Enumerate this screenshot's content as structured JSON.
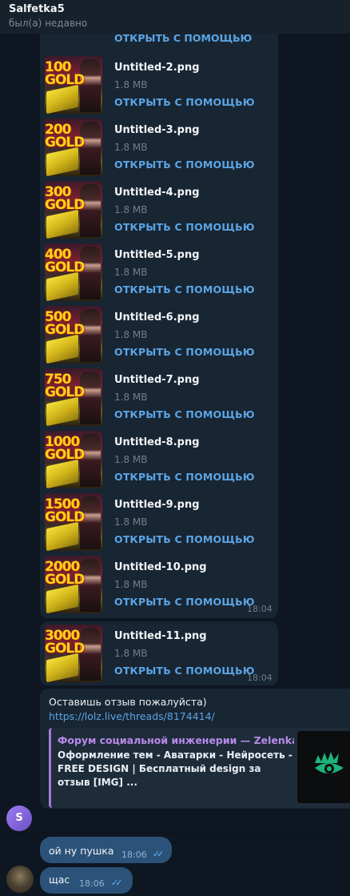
{
  "header": {
    "name": "Salfetka5",
    "status": "был(а) недавно"
  },
  "top_partial_open": "ОТКРЫТЬ С ПОМОЩЬЮ",
  "files": [
    {
      "name": "Untitled-2.png",
      "size": "1.8 MB",
      "open": "ОТКРЫТЬ С ПОМОЩЬЮ",
      "thumb_text": "100\nGOLD"
    },
    {
      "name": "Untitled-3.png",
      "size": "1.8 MB",
      "open": "ОТКРЫТЬ С ПОМОЩЬЮ",
      "thumb_text": "200\nGOLD"
    },
    {
      "name": "Untitled-4.png",
      "size": "1.8 MB",
      "open": "ОТКРЫТЬ С ПОМОЩЬЮ",
      "thumb_text": "300\nGOLD"
    },
    {
      "name": "Untitled-5.png",
      "size": "1.8 MB",
      "open": "ОТКРЫТЬ С ПОМОЩЬЮ",
      "thumb_text": "400\nGOLD"
    },
    {
      "name": "Untitled-6.png",
      "size": "1.8 MB",
      "open": "ОТКРЫТЬ С ПОМОЩЬЮ",
      "thumb_text": "500\nGOLD"
    },
    {
      "name": "Untitled-7.png",
      "size": "1.8 MB",
      "open": "ОТКРЫТЬ С ПОМОЩЬЮ",
      "thumb_text": "750\nGOLD"
    },
    {
      "name": "Untitled-8.png",
      "size": "1.8 MB",
      "open": "ОТКРЫТЬ С ПОМОЩЬЮ",
      "thumb_text": "1000\nGOLD"
    },
    {
      "name": "Untitled-9.png",
      "size": "1.8 MB",
      "open": "ОТКРЫТЬ С ПОМОЩЬЮ",
      "thumb_text": "1500\nGOLD"
    },
    {
      "name": "Untitled-10.png",
      "size": "1.8 MB",
      "open": "ОТКРЫТЬ С ПОМОЩЬЮ",
      "thumb_text": "2000\nGOLD"
    },
    {
      "name": "Untitled-11.png",
      "size": "1.8 MB",
      "open": "ОТКРЫТЬ С ПОМОЩЬЮ",
      "thumb_text": "3000\nGOLD"
    }
  ],
  "group_time_1": "18:04",
  "group_time_2": "18:04",
  "review": {
    "text": "Оставишь отзыв пожалуйста)",
    "link": "https://lolz.live/threads/8174414/",
    "preview_title": "Форум социальной инженерии — Zelenka....",
    "preview_desc": "Оформление тем - Аватарки - Нейросеть - FREE DESIGN | Бесплатный design за отзыв [IMG] ..."
  },
  "sender_initial": "S",
  "replies": [
    {
      "text": "ой ну пушка",
      "time": "18:06"
    },
    {
      "text": "щас",
      "time": "18:06"
    }
  ],
  "colors": {
    "background": "#0e1621",
    "incoming_bubble": "#182533",
    "outgoing_bubble": "#2b5278",
    "accent": "#5ba5e5",
    "link_title": "#b98aeb"
  }
}
